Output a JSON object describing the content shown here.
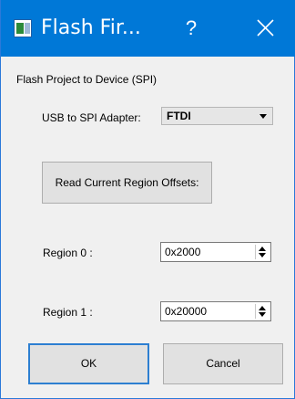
{
  "window": {
    "title": "Flash Fir...",
    "help_label": "?",
    "accent_color": "#0078d7"
  },
  "form": {
    "heading": "Flash Project to Device (SPI)",
    "adapter_label": "USB to SPI Adapter:",
    "adapter_value": "FTDI",
    "read_offsets_label": "Read Current Region Offsets:",
    "region0_label": "Region 0 :",
    "region0_value": "0x2000",
    "region1_label": "Region 1 :",
    "region1_value": "0x20000"
  },
  "buttons": {
    "ok_label": "OK",
    "cancel_label": "Cancel"
  }
}
